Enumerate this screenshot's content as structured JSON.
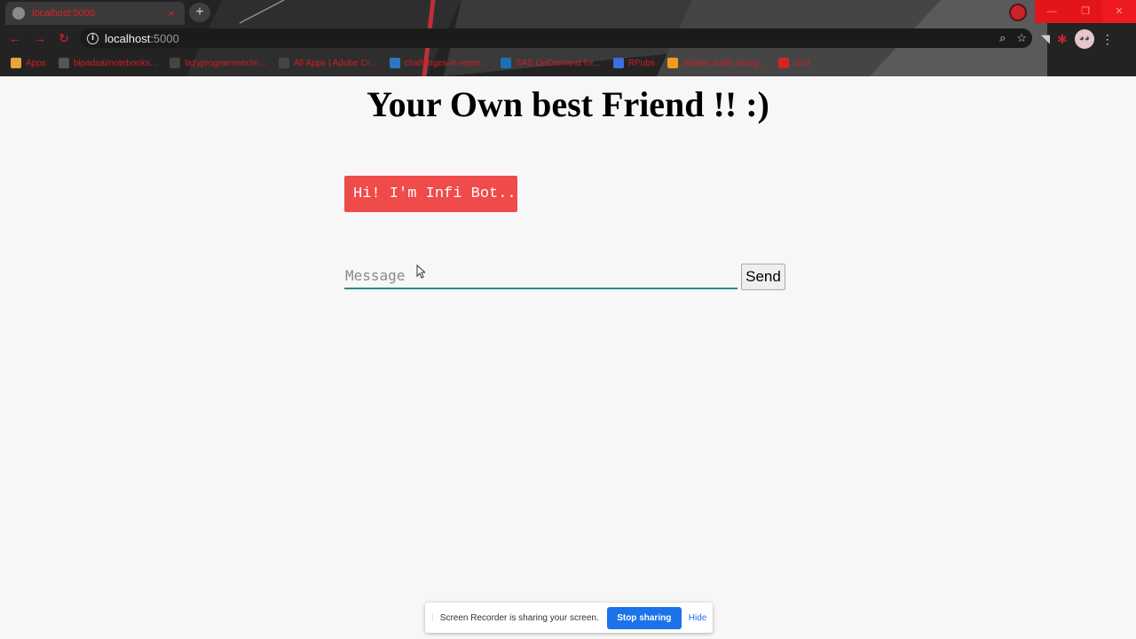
{
  "browser": {
    "tab_title": "localhost:5000",
    "tab_close": "×",
    "new_tab": "+",
    "url_host": "localhost",
    "url_port": ":5000",
    "info_icon": "i",
    "bookmarks": [
      {
        "label": "Apps",
        "icon": "apps-grid-icon",
        "color": "#e8a33a"
      },
      {
        "label": "bipadsai/notebooks...",
        "icon": "github-icon",
        "color": "#555555"
      },
      {
        "label": "lazyprogrammer/m...",
        "icon": "github-icon",
        "color": "#444444"
      },
      {
        "label": "All Apps | Adobe Cr...",
        "icon": "adobe-icon",
        "color": "#444444"
      },
      {
        "label": "challenges-in-repre...",
        "icon": "kaggle-icon",
        "color": "#2b78c2"
      },
      {
        "label": "SAS OnDemand for...",
        "icon": "sas-icon",
        "color": "#1f6fb8"
      },
      {
        "label": "RPubs",
        "icon": "rpubs-icon",
        "color": "#3b6fd9"
      },
      {
        "label": "Simple audio recog...",
        "icon": "tensorflow-icon",
        "color": "#f39a1e"
      },
      {
        "label": "cma",
        "icon": "cma-icon",
        "color": "#d32424"
      }
    ]
  },
  "page": {
    "title": "Your Own best Friend !! :)",
    "bot_message": "Hi! I'm Infi Bot..",
    "input_placeholder": "Message",
    "input_value": "",
    "send_label": "Send"
  },
  "recorder": {
    "text": "Screen Recorder is sharing your screen.",
    "stop_label": "Stop sharing",
    "hide_label": "Hide"
  },
  "colors": {
    "bot_bubble": "#ef4b4b",
    "input_underline": "#1f8f86",
    "stop_button": "#1a73e8"
  }
}
